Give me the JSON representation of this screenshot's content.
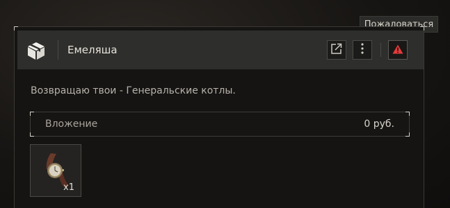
{
  "tooltip": {
    "text": "Пожаловаться"
  },
  "header": {
    "title": "Емеляша",
    "icons": {
      "sender": "box-icon",
      "open": "external-link-icon",
      "more": "kebab-menu-icon",
      "report": "warning-triangle-icon"
    }
  },
  "message": {
    "text": "Возвращаю твои - Генеральские котлы."
  },
  "attachment": {
    "label": "Вложение",
    "value": "0 руб."
  },
  "items": [
    {
      "icon": "wristwatch-icon",
      "quantity": "x1"
    }
  ],
  "colors": {
    "report_accent": "#e23b3b",
    "panel_bg": "#151413",
    "header_bg": "#2e2e2c"
  }
}
